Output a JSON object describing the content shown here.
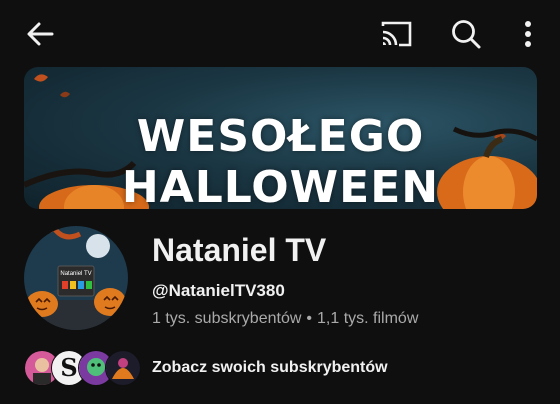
{
  "colors": {
    "background": "#0f0f0f",
    "text_primary": "#f1f1f1",
    "text_secondary": "#aaaaaa",
    "banner_teal": "#1b3744",
    "pumpkin": "#e2701d"
  },
  "topbar": {
    "icons": [
      "back-arrow-icon",
      "cast-icon",
      "search-icon",
      "more-vert-icon"
    ]
  },
  "banner": {
    "title": "WESOŁEGO HALLOWEEN"
  },
  "avatar": {
    "label": "Nataniel TV"
  },
  "channel": {
    "name": "Nataniel TV",
    "handle": "@NatanielTV380",
    "subscribers": "1 tys. subskrybentów",
    "separator": "•",
    "videos": "1,1 tys. filmów"
  },
  "subscribers_row": {
    "link_label": "Zobacz swoich subskrybentów",
    "avatar_count": 4
  }
}
